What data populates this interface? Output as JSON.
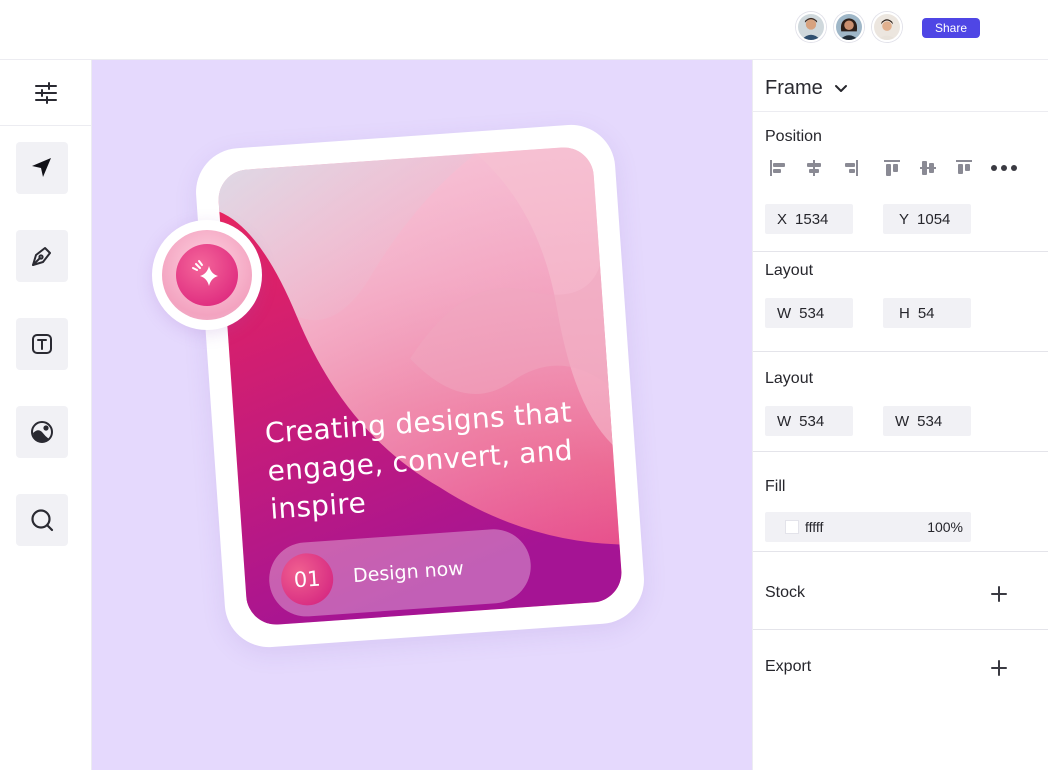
{
  "header": {
    "collaborators": [
      {
        "name": "avatar-1"
      },
      {
        "name": "avatar-2"
      },
      {
        "name": "avatar-3"
      }
    ],
    "share_label": "Share"
  },
  "toolbar": {
    "settings_icon": "sliders-icon",
    "tools": [
      {
        "id": "navigate",
        "icon": "navigation-arrow-icon"
      },
      {
        "id": "pen",
        "icon": "pen-tool-icon"
      },
      {
        "id": "text",
        "icon": "text-tool-icon"
      },
      {
        "id": "color",
        "icon": "palette-icon"
      },
      {
        "id": "search",
        "icon": "search-icon"
      }
    ]
  },
  "canvas": {
    "card": {
      "title": "Creating designs that engage, convert, and inspire",
      "cta_number": "01",
      "cta_label": "Design now",
      "badge_icon": "sparkle-icon"
    }
  },
  "panel": {
    "frame_title": "Frame",
    "position": {
      "label": "Position",
      "x_label": "X",
      "x_value": "1534",
      "y_label": "Y",
      "y_value": "1054"
    },
    "layout1": {
      "label": "Layout",
      "w_label": "W",
      "w_value": "534",
      "h_label": "H",
      "h_value": "54"
    },
    "layout2": {
      "label": "Layout",
      "w1_label": "W",
      "w1_value": "534",
      "w2_label": "W",
      "w2_value": "534"
    },
    "fill": {
      "label": "Fill",
      "hex": "fffff",
      "opacity": "100%",
      "swatch_color": "#ffffff"
    },
    "stock_label": "Stock",
    "export_label": "Export"
  },
  "colors": {
    "accent": "#4f46e5",
    "canvas_bg": "#e5d9fd",
    "card_pink": "#e0287a",
    "card_purple": "#b2179f"
  }
}
